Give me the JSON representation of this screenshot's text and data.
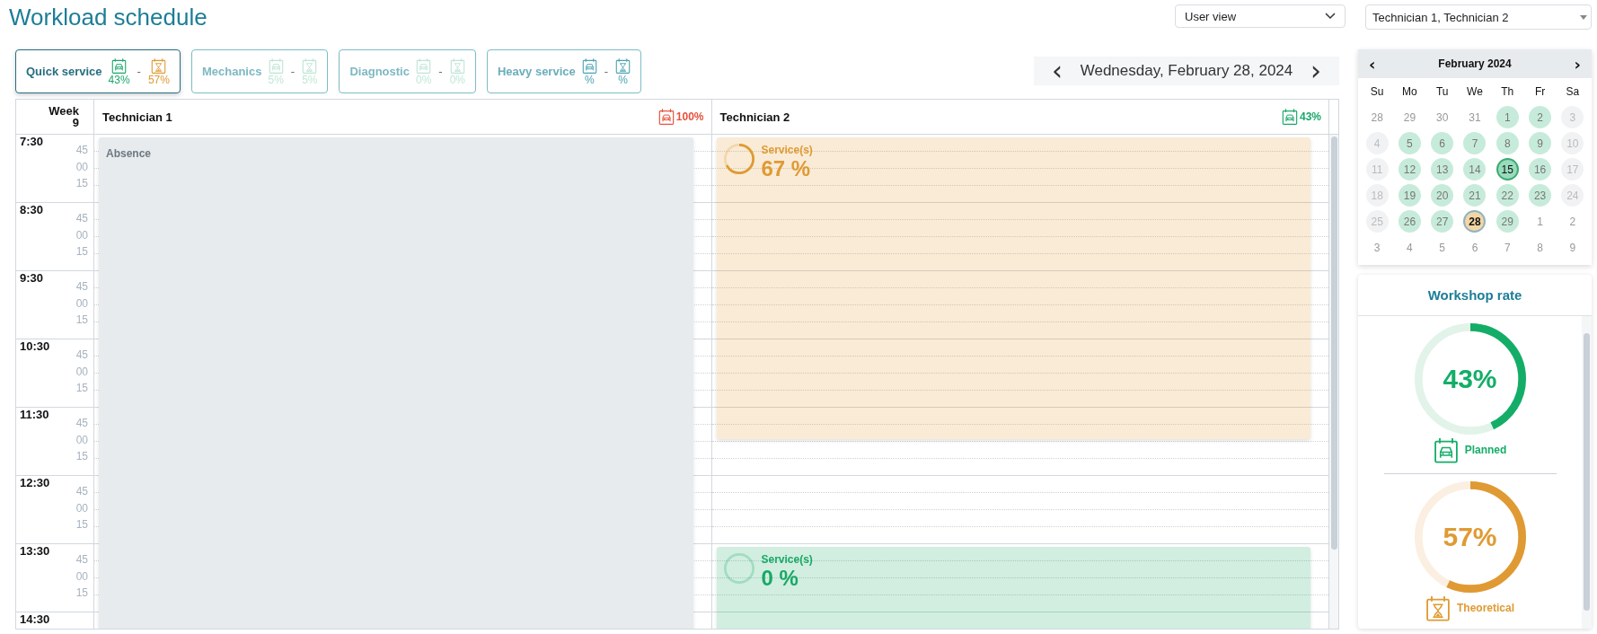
{
  "title": "Workload schedule",
  "view_select": {
    "value": "User view"
  },
  "technician_select": {
    "value": "Technician 1, Technician 2"
  },
  "tabs": [
    {
      "label": "Quick service",
      "selected": true,
      "disabled": false,
      "planned": "43%",
      "separator": "-",
      "theoretical": "57%"
    },
    {
      "label": "Mechanics",
      "selected": false,
      "disabled": true,
      "planned": "5%",
      "separator": "-",
      "theoretical": "5%"
    },
    {
      "label": "Diagnostic",
      "selected": false,
      "disabled": true,
      "planned": "0%",
      "separator": "-",
      "theoretical": "0%"
    },
    {
      "label": "Heavy service",
      "selected": false,
      "disabled": false,
      "planned": "%",
      "separator": "-",
      "theoretical": "%"
    }
  ],
  "date_nav": {
    "prev": "‹",
    "date": "Wednesday, February 28, 2024",
    "next": "›"
  },
  "schedule": {
    "week_label": "Week",
    "week_number": "9",
    "hours": [
      {
        "hour": "7:30",
        "marks": [
          "45",
          "00",
          "15"
        ]
      },
      {
        "hour": "8:30",
        "marks": [
          "45",
          "00",
          "15"
        ]
      },
      {
        "hour": "9:30",
        "marks": [
          "45",
          "00",
          "15"
        ]
      },
      {
        "hour": "10:30",
        "marks": [
          "45",
          "00",
          "15"
        ]
      },
      {
        "hour": "11:30",
        "marks": [
          "45",
          "00",
          "15"
        ]
      },
      {
        "hour": "12:30",
        "marks": [
          "45",
          "00",
          "15"
        ]
      },
      {
        "hour": "13:30",
        "marks": [
          "45",
          "00",
          "15"
        ]
      },
      {
        "hour": "14:30"
      }
    ],
    "technicians": [
      {
        "name": "Technician 1",
        "rate": "100%",
        "color": "#e5533d",
        "quarters": [
          {
            "kind": "absence",
            "label": "Absence"
          },
          {
            "kind": "absence"
          },
          {
            "kind": "absence"
          },
          {
            "kind": "absence"
          },
          {
            "kind": "absence"
          },
          {
            "kind": "absence"
          },
          {
            "kind": "absence"
          },
          {
            "kind": "absence"
          },
          {
            "kind": "absence"
          },
          {
            "kind": "absence"
          },
          {
            "kind": "absence"
          },
          {
            "kind": "absence"
          },
          {
            "kind": "absence"
          },
          {
            "kind": "absence"
          },
          {
            "kind": "absence"
          },
          {
            "kind": "absence"
          },
          {
            "kind": "absence"
          },
          {
            "kind": "absence"
          },
          {
            "kind": "absence"
          },
          {
            "kind": "absence"
          },
          {
            "kind": "absence"
          },
          {
            "kind": "absence"
          },
          {
            "kind": "absence"
          },
          {
            "kind": "absence"
          },
          {
            "kind": "absence"
          },
          {
            "kind": "absence"
          },
          {
            "kind": "absence"
          },
          {
            "kind": "absence"
          },
          {
            "kind": "absence"
          }
        ]
      },
      {
        "name": "Technician 2",
        "rate": "43%",
        "color": "#1aa86a",
        "quarters": [
          {
            "kind": "service",
            "label": "Service(s)",
            "value": "67 %",
            "level": 0.67,
            "color": "#e09a33"
          },
          {
            "kind": "service"
          },
          {
            "kind": "service"
          },
          {
            "kind": "service"
          },
          {
            "kind": "service"
          },
          {
            "kind": "service"
          },
          {
            "kind": "service"
          },
          {
            "kind": "service"
          },
          {
            "kind": "service"
          },
          {
            "kind": "service"
          },
          {
            "kind": "service"
          },
          {
            "kind": "service"
          },
          {
            "kind": "service"
          },
          {
            "kind": "service"
          },
          {
            "kind": "service"
          },
          {
            "kind": "service"
          },
          {
            "kind": "service"
          },
          {
            "kind": "service"
          },
          {
            "kind": "free"
          },
          {
            "kind": "free"
          },
          {
            "kind": "free"
          },
          {
            "kind": "free"
          },
          {
            "kind": "free"
          },
          {
            "kind": "free"
          },
          {
            "kind": "service",
            "label": "Service(s)",
            "value": "0 %",
            "level": 0,
            "color": "#19a866"
          },
          {
            "kind": "service"
          },
          {
            "kind": "service"
          },
          {
            "kind": "service"
          },
          {
            "kind": "service"
          }
        ]
      }
    ]
  },
  "calendar": {
    "prev": "‹",
    "month": "February 2024",
    "next": "›",
    "weekdays": [
      "Su",
      "Mo",
      "Tu",
      "We",
      "Th",
      "Fr",
      "Sa"
    ],
    "days": [
      {
        "day": "28",
        "kind": "outside",
        "selected": false,
        "today": false
      },
      {
        "day": "29",
        "kind": "outside",
        "selected": false,
        "today": false
      },
      {
        "day": "30",
        "kind": "outside",
        "selected": false,
        "today": false
      },
      {
        "day": "31",
        "kind": "outside",
        "selected": false,
        "today": false
      },
      {
        "day": "1",
        "kind": "open",
        "selected": false,
        "today": false
      },
      {
        "day": "2",
        "kind": "open",
        "selected": false,
        "today": false
      },
      {
        "day": "3",
        "kind": "closed",
        "selected": false,
        "today": false
      },
      {
        "day": "4",
        "kind": "closed",
        "selected": false,
        "today": false
      },
      {
        "day": "5",
        "kind": "open",
        "selected": false,
        "today": false
      },
      {
        "day": "6",
        "kind": "open",
        "selected": false,
        "today": false
      },
      {
        "day": "7",
        "kind": "open",
        "selected": false,
        "today": false
      },
      {
        "day": "8",
        "kind": "open",
        "selected": false,
        "today": false
      },
      {
        "day": "9",
        "kind": "open",
        "selected": false,
        "today": false
      },
      {
        "day": "10",
        "kind": "closed",
        "selected": false,
        "today": false
      },
      {
        "day": "11",
        "kind": "closed",
        "selected": false,
        "today": false
      },
      {
        "day": "12",
        "kind": "open",
        "selected": false,
        "today": false
      },
      {
        "day": "13",
        "kind": "open",
        "selected": false,
        "today": false
      },
      {
        "day": "14",
        "kind": "open",
        "selected": false,
        "today": false
      },
      {
        "day": "15",
        "kind": "open",
        "selected": false,
        "today": true
      },
      {
        "day": "16",
        "kind": "open",
        "selected": false,
        "today": false
      },
      {
        "day": "17",
        "kind": "closed",
        "selected": false,
        "today": false
      },
      {
        "day": "18",
        "kind": "closed",
        "selected": false,
        "today": false
      },
      {
        "day": "19",
        "kind": "open",
        "selected": false,
        "today": false
      },
      {
        "day": "20",
        "kind": "open",
        "selected": false,
        "today": false
      },
      {
        "day": "21",
        "kind": "open",
        "selected": false,
        "today": false
      },
      {
        "day": "22",
        "kind": "open",
        "selected": false,
        "today": false
      },
      {
        "day": "23",
        "kind": "open",
        "selected": false,
        "today": false
      },
      {
        "day": "24",
        "kind": "closed",
        "selected": false,
        "today": false
      },
      {
        "day": "25",
        "kind": "closed",
        "selected": false,
        "today": false
      },
      {
        "day": "26",
        "kind": "open",
        "selected": false,
        "today": false
      },
      {
        "day": "27",
        "kind": "open",
        "selected": false,
        "today": false
      },
      {
        "day": "28",
        "kind": "open",
        "selected": true,
        "today": false
      },
      {
        "day": "29",
        "kind": "open",
        "selected": false,
        "today": false
      },
      {
        "day": "1",
        "kind": "outside",
        "selected": false,
        "today": false
      },
      {
        "day": "2",
        "kind": "outside",
        "selected": false,
        "today": false
      },
      {
        "day": "3",
        "kind": "outside",
        "selected": false,
        "today": false
      },
      {
        "day": "4",
        "kind": "outside",
        "selected": false,
        "today": false
      },
      {
        "day": "5",
        "kind": "outside",
        "selected": false,
        "today": false
      },
      {
        "day": "6",
        "kind": "outside",
        "selected": false,
        "today": false
      },
      {
        "day": "7",
        "kind": "outside",
        "selected": false,
        "today": false
      },
      {
        "day": "8",
        "kind": "outside",
        "selected": false,
        "today": false
      },
      {
        "day": "9",
        "kind": "outside",
        "selected": false,
        "today": false
      }
    ]
  },
  "workshop_rate": {
    "title": "Workshop rate",
    "gauges": [
      {
        "kind": "planned",
        "value": "43%",
        "level": 0.43,
        "label": "Planned"
      },
      {
        "kind": "theoretical",
        "value": "57%",
        "level": 0.57,
        "label": "Theoretical"
      }
    ]
  }
}
